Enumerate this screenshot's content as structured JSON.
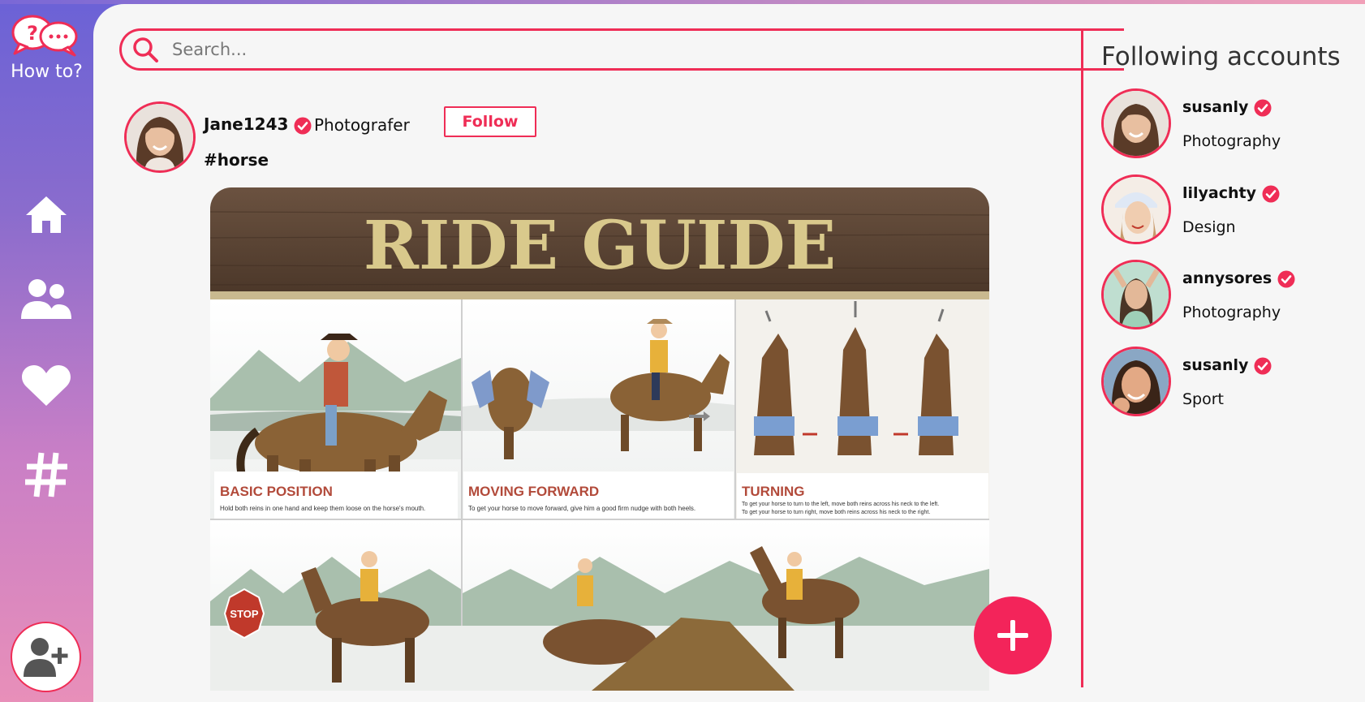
{
  "app": {
    "logo_text": "How to?"
  },
  "nav": [
    {
      "icon": "home-icon"
    },
    {
      "icon": "users-icon"
    },
    {
      "icon": "heart-icon"
    },
    {
      "icon": "hashtag-icon"
    }
  ],
  "search": {
    "placeholder": "Search..."
  },
  "post": {
    "username": "Jane1243",
    "role": "Photografer",
    "follow_label": "Follow",
    "hashtag": "#horse",
    "image": {
      "title": "RIDE GUIDE",
      "panels": [
        {
          "heading": "BASIC POSITION",
          "text": "Hold both reins in one hand and keep them loose on the horse's mouth."
        },
        {
          "heading": "MOVING FORWARD",
          "text": "To get your horse to move forward, give him a good firm nudge with both heels."
        },
        {
          "heading": "TURNING",
          "text": "To get your horse to turn to the left, move both reins across his neck to the left.",
          "text2": "To get your horse to turn right, move both reins across his neck to the right."
        }
      ],
      "stop_sign": "STOP"
    }
  },
  "following": {
    "title": "Following accounts",
    "accounts": [
      {
        "name": "susanly",
        "category": "Photography"
      },
      {
        "name": "lilyachty",
        "category": "Design"
      },
      {
        "name": "annysores",
        "category": "Photography"
      },
      {
        "name": "susanly",
        "category": "Sport"
      }
    ]
  },
  "colors": {
    "accent": "#ef2d56",
    "fab": "#f3245a",
    "panel": "#f6f6f6"
  }
}
